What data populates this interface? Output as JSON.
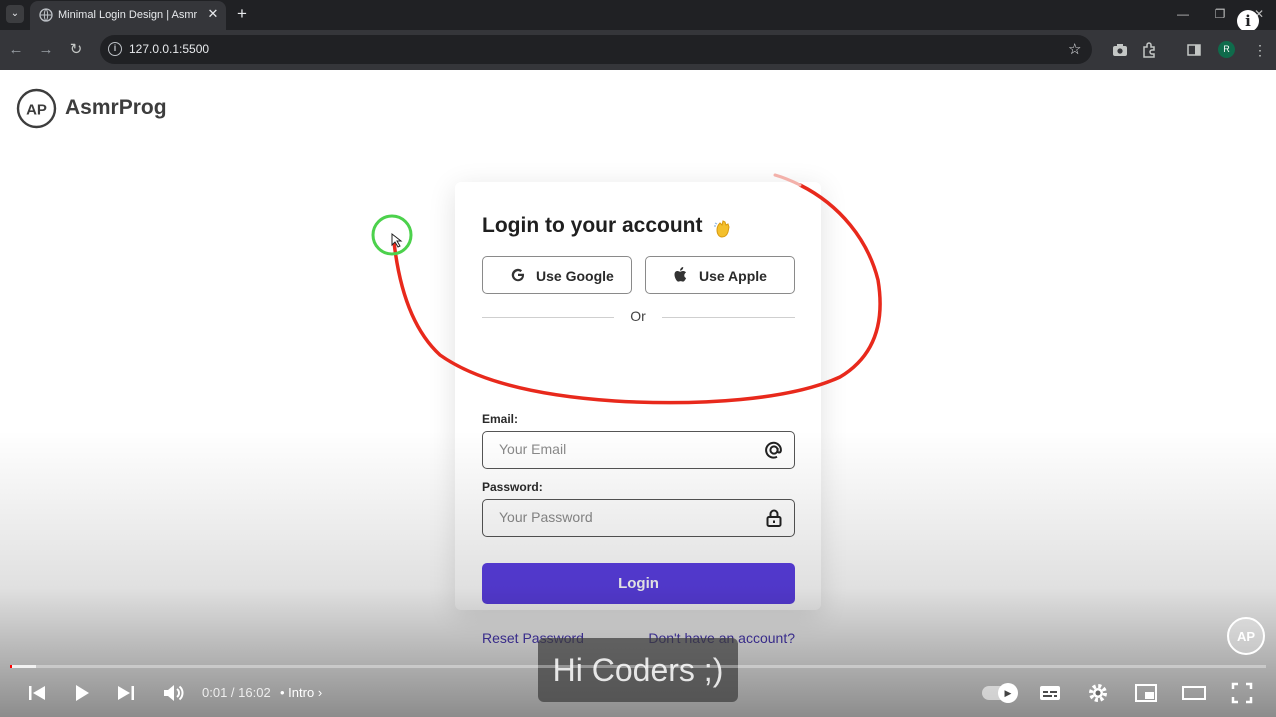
{
  "browser": {
    "tab_title": "Minimal Login Design | AsmrProg",
    "tab_close": "✕",
    "new_tab": "+",
    "url": "127.0.0.1:5500",
    "profile_initial": "R",
    "info_badge": "i",
    "icons": [
      "tab-search-icon",
      "back-arrow-icon",
      "forward-arrow-icon",
      "reload-icon",
      "site-info-icon",
      "bookmark-star-icon",
      "camera-icon",
      "extensions-icon",
      "side-panel-icon",
      "menu-dots-icon",
      "minimize-icon",
      "restore-icon",
      "close-icon"
    ]
  },
  "site": {
    "brand": "AsmrProg",
    "logo_text": "AP"
  },
  "login": {
    "title": "Login to your account",
    "title_emoji_icon": "waving-hand-icon",
    "google_label": "Use Google",
    "apple_label": "Use Apple",
    "divider": "Or",
    "email_label": "Email:",
    "email_placeholder": "Your Email",
    "password_label": "Password:",
    "password_placeholder": "Your Password",
    "login_button": "Login",
    "reset_link": "Reset Password",
    "signup_link": "Don't have an account?"
  },
  "player": {
    "caption": "Hi Coders ;)",
    "time": "0:01 / 16:02",
    "chapter": "• Intro",
    "progress_fraction": 0.001
  },
  "colors": {
    "accent": "#5b3fe4",
    "link": "#4a39b8",
    "annotation_red": "#e8291c",
    "cursor_ring": "#4cd14c"
  }
}
